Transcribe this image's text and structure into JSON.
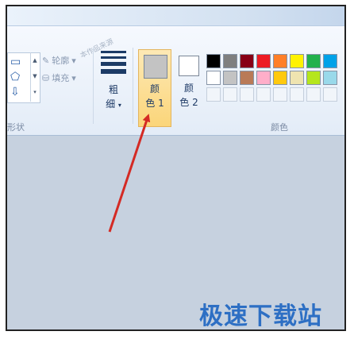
{
  "ribbon": {
    "shapes_group_label": "形状",
    "outline_label": "轮廓",
    "fill_label": "填充",
    "size_label_line1": "粗",
    "size_label_line2": "细",
    "color1_label_line1": "颜",
    "color1_label_line2": "色 1",
    "color2_label_line1": "颜",
    "color2_label_line2": "色 2",
    "colors_group_label": "颜色",
    "faint_overlay_text": "本作品来源"
  },
  "colors": {
    "color1": "#c3c3c3",
    "color2": "#ffffff",
    "palette_row1": [
      "#000000",
      "#7f7f7f",
      "#880015",
      "#ed1c24",
      "#ff7f27",
      "#fff200",
      "#22b14c",
      "#00a2e8"
    ],
    "palette_row2": [
      "#ffffff",
      "#c3c3c3",
      "#b97a57",
      "#ffaec9",
      "#ffc90e",
      "#efe4b0",
      "#b5e61d",
      "#99d9ea"
    ],
    "palette_row3_empty": 8
  },
  "annotation": {
    "arrow_color": "#d42a24"
  },
  "watermark": {
    "text": "极速下载站"
  },
  "icons": [
    "rectangle-shape-icon",
    "pentagon-shape-icon",
    "arrow-shape-icon",
    "pencil-outline-icon",
    "fill-bucket-icon",
    "line-size-icon",
    "dropdown-arrow-icon",
    "scroll-up-icon",
    "scroll-down-icon",
    "more-shapes-icon"
  ]
}
